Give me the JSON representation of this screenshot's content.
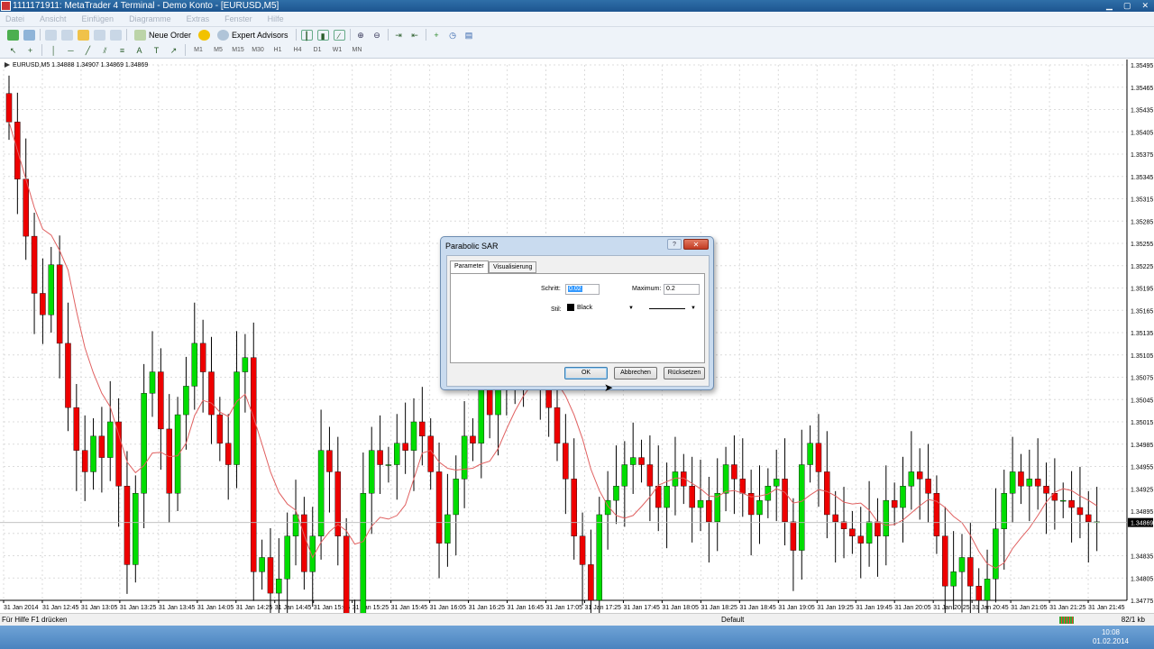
{
  "window": {
    "title": "1111171911: MetaTrader 4 Terminal - Demo Konto - [EURUSD,M5]"
  },
  "menu": [
    "Datei",
    "Ansicht",
    "Einfügen",
    "Diagramme",
    "Extras",
    "Fenster",
    "Hilfe"
  ],
  "toolbar": {
    "new_order": "Neue Order",
    "expert_advisors": "Expert Advisors"
  },
  "timeframes": [
    "M1",
    "M5",
    "M15",
    "M30",
    "H1",
    "H4",
    "D1",
    "W1",
    "MN"
  ],
  "chart": {
    "symbol_info": "EURUSD,M5  1.34888 1.34907 1.34869 1.34869",
    "price_labels": [
      "1.35495",
      "1.35465",
      "1.35435",
      "1.35405",
      "1.35375",
      "1.35345",
      "1.35315",
      "1.35285",
      "1.35255",
      "1.35225",
      "1.35195",
      "1.35165",
      "1.35135",
      "1.35105",
      "1.35075",
      "1.35045",
      "1.35015",
      "1.34985",
      "1.34955",
      "1.34925",
      "1.34895",
      "1.34869",
      "1.34835",
      "1.34805",
      "1.34775"
    ],
    "time_labels": [
      "31 Jan 2014",
      "31 Jan 12:45",
      "31 Jan 13:05",
      "31 Jan 13:25",
      "31 Jan 13:45",
      "31 Jan 14:05",
      "31 Jan 14:25",
      "31 Jan 14:45",
      "31 Jan 15:05",
      "31 Jan 15:25",
      "31 Jan 15:45",
      "31 Jan 16:05",
      "31 Jan 16:25",
      "31 Jan 16:45",
      "31 Jan 17:05",
      "31 Jan 17:25",
      "31 Jan 17:45",
      "31 Jan 18:05",
      "31 Jan 18:25",
      "31 Jan 18:45",
      "31 Jan 19:05",
      "31 Jan 19:25",
      "31 Jan 19:45",
      "31 Jan 20:05",
      "31 Jan 20:25",
      "31 Jan 20:45",
      "31 Jan 21:05",
      "31 Jan 21:25",
      "31 Jan 21:45"
    ],
    "current_price": "1.34869",
    "bull_color": "#00dd00",
    "bear_color": "#ee0000",
    "ma_color": "#e06060"
  },
  "chart_data": {
    "type": "candlestick",
    "ylim": [
      1.3476,
      1.3551
    ],
    "closes": [
      1.3543,
      1.3535,
      1.3527,
      1.3519,
      1.3516,
      1.3523,
      1.3512,
      1.3503,
      1.3497,
      1.3494,
      1.3499,
      1.3496,
      1.3501,
      1.3492,
      1.3481,
      1.3491,
      1.3505,
      1.3508,
      1.35,
      1.3491,
      1.3502,
      1.3506,
      1.3512,
      1.3508,
      1.3502,
      1.3498,
      1.3495,
      1.3508,
      1.351,
      1.348,
      1.3482,
      1.3477,
      1.3479,
      1.3485,
      1.3488,
      1.348,
      1.3485,
      1.3497,
      1.3494,
      1.3485,
      1.3472,
      1.347,
      1.3491,
      1.3497,
      1.3495,
      1.3495,
      1.3498,
      1.3497,
      1.3501,
      1.3499,
      1.3494,
      1.3484,
      1.3488,
      1.3493,
      1.3499,
      1.3498,
      1.3506,
      1.3502,
      1.3508,
      1.3506,
      1.3508,
      1.351,
      1.3512,
      1.3507,
      1.3503,
      1.3498,
      1.3493,
      1.3485,
      1.3481,
      1.3476,
      1.3488,
      1.349,
      1.3492,
      1.3495,
      1.3496,
      1.3495,
      1.3492,
      1.3489,
      1.3492,
      1.3494,
      1.3492,
      1.3489,
      1.349,
      1.3487,
      1.3491,
      1.3495,
      1.3493,
      1.3491,
      1.3488,
      1.349,
      1.3492,
      1.3493,
      1.3487,
      1.3483,
      1.3495,
      1.3498,
      1.3494,
      1.3488,
      1.3487,
      1.3486,
      1.3485,
      1.3484,
      1.3487,
      1.3485,
      1.349,
      1.3489,
      1.3492,
      1.3494,
      1.3493,
      1.3491,
      1.3485,
      1.3478,
      1.348,
      1.3482,
      1.3478,
      1.3476,
      1.3479,
      1.3486,
      1.3491,
      1.3494,
      1.3492,
      1.3493,
      1.3492,
      1.3491,
      1.349,
      1.349,
      1.3489,
      1.3488,
      1.3487,
      1.3487
    ]
  },
  "dialog": {
    "title": "Parabolic SAR",
    "help": "?",
    "close": "✕",
    "tabs": [
      "Parameter",
      "Visualisierung"
    ],
    "step_label": "Schritt:",
    "step_value": "0.02",
    "maximum_label": "Maximum:",
    "maximum_value": "0.2",
    "style_label": "Stil:",
    "color_value": "Black",
    "ok": "OK",
    "cancel": "Abbrechen",
    "reset": "Rücksetzen"
  },
  "status": {
    "help": "Für Hilfe F1 drücken",
    "profile": "Default",
    "traffic": "82/1 kb"
  },
  "clock": {
    "time": "10:08",
    "date": "01.02.2014"
  }
}
